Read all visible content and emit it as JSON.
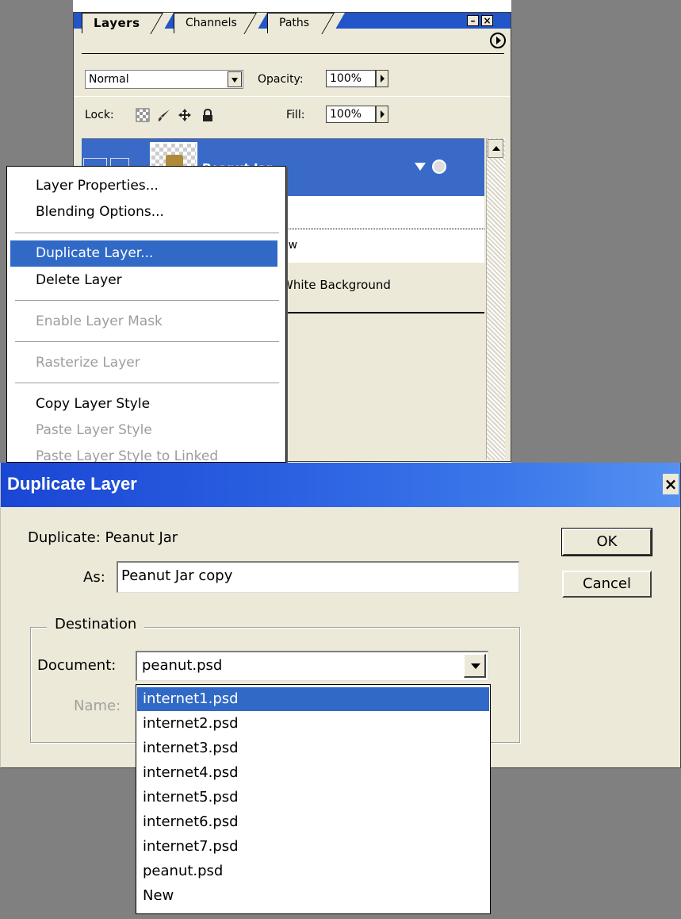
{
  "layers_panel": {
    "tabs": [
      "Layers",
      "Channels",
      "Paths"
    ],
    "blend_mode": "Normal",
    "opacity_label": "Opacity:",
    "opacity_value": "100%",
    "lock_label": "Lock:",
    "fill_label": "Fill:",
    "fill_value": "100%",
    "layers": [
      {
        "name": "Peanut Jar",
        "selected": true
      },
      {
        "name": "",
        "selected": false
      },
      {
        "name": "ow",
        "selected": false
      },
      {
        "name": "White Background",
        "selected": false
      }
    ]
  },
  "context_menu": {
    "items": [
      {
        "label": "Layer Properties...",
        "state": "enabled"
      },
      {
        "label": "Blending Options...",
        "state": "enabled"
      },
      {
        "label": "Duplicate Layer...",
        "state": "highlighted"
      },
      {
        "label": "Delete Layer",
        "state": "enabled"
      },
      {
        "label": "Enable Layer Mask",
        "state": "disabled"
      },
      {
        "label": "Rasterize Layer",
        "state": "disabled"
      },
      {
        "label": "Copy Layer Style",
        "state": "enabled"
      },
      {
        "label": "Paste Layer Style",
        "state": "disabled"
      },
      {
        "label": "Paste Layer Style to Linked",
        "state": "disabled"
      }
    ]
  },
  "dialog": {
    "title": "Duplicate Layer",
    "close_symbol": "×",
    "duplicate_label": "Duplicate: Peanut Jar",
    "as_label": "As:",
    "as_value": "Peanut Jar copy",
    "ok_label": "OK",
    "cancel_label": "Cancel",
    "destination_label": "Destination",
    "document_label": "Document:",
    "document_value": "peanut.psd",
    "name_label": "Name:",
    "document_options": [
      "internet1.psd",
      "internet2.psd",
      "internet3.psd",
      "internet4.psd",
      "internet5.psd",
      "internet6.psd",
      "internet7.psd",
      "peanut.psd",
      "New"
    ],
    "highlighted_option": "internet1.psd"
  },
  "colors": {
    "selection_blue": "#3169c6",
    "title_blue": "#2155c8",
    "face": "#ece9d8",
    "backdrop_gray": "#808080"
  }
}
